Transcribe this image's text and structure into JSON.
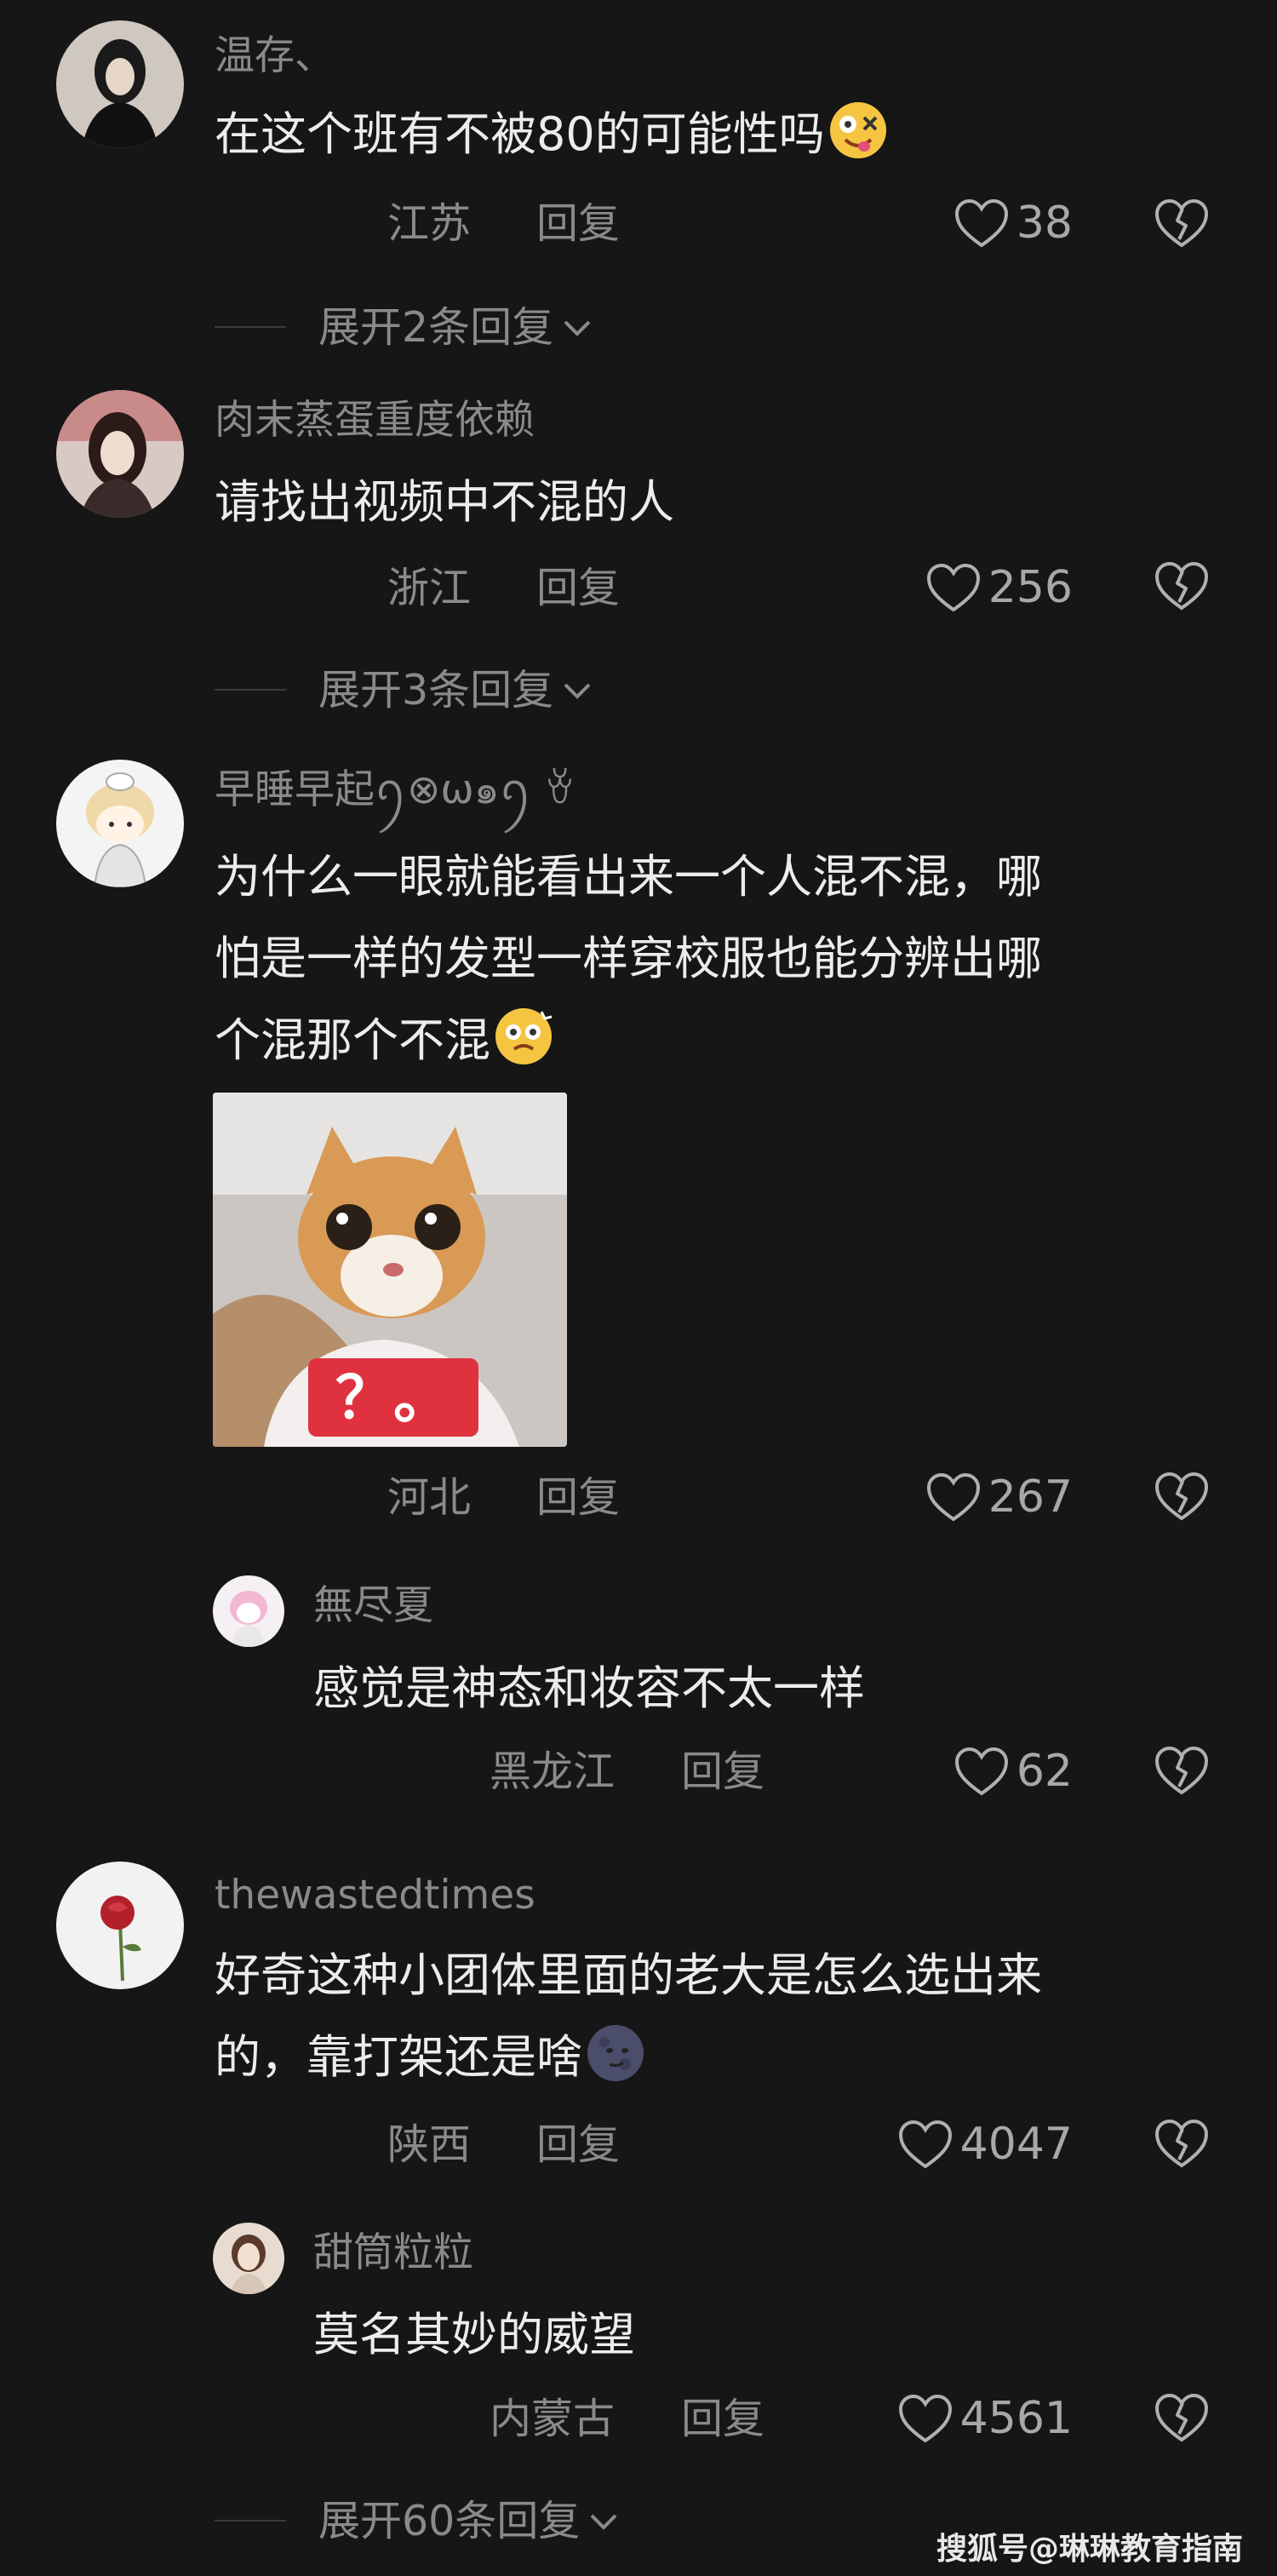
{
  "comments": [
    {
      "username": "温存、",
      "lines": [
        "在这个班有不被80的可能性吗"
      ],
      "emoji": "crazy-face-emoji",
      "location": "江苏",
      "reply_label": "回复",
      "likes": "38",
      "expand_label": "展开2条回复"
    },
    {
      "username": "肉末蒸蛋重度依赖",
      "lines": [
        "请找出视频中不混的人"
      ],
      "location": "浙江",
      "reply_label": "回复",
      "likes": "256",
      "expand_label": "展开3条回复"
    },
    {
      "username": "早睡早起ꪆ⊗ω๑ꪆ ꈊ",
      "lines": [
        "为什么一眼就能看出来一个人混不混，哪",
        "怕是一样的发型一样穿校服也能分辨出哪",
        "个混那个不混"
      ],
      "emoji": "dizzy-face-emoji",
      "image_text": "？。",
      "location": "河北",
      "reply_label": "回复",
      "likes": "267",
      "replies": [
        {
          "username": "無尽夏",
          "text": "感觉是神态和妆容不太一样",
          "location": "黑龙江",
          "reply_label": "回复",
          "likes": "62"
        }
      ]
    },
    {
      "username": "thewastedtimes",
      "lines": [
        "好奇这种小团体里面的老大是怎么选出来",
        "的，靠打架还是啥"
      ],
      "emoji": "new-moon-face-emoji",
      "location": "陕西",
      "reply_label": "回复",
      "likes": "4047",
      "replies": [
        {
          "username": "甜筒粒粒",
          "text": "莫名其妙的威望",
          "location": "内蒙古",
          "reply_label": "回复",
          "likes": "4561"
        }
      ],
      "expand_label": "展开60条回复"
    }
  ],
  "watermark": "搜狐号@琳琳教育指南",
  "colors": {
    "background": "#161616",
    "username": "#8a8a8a",
    "text": "#ececec",
    "meta": "#8a8a8a"
  }
}
